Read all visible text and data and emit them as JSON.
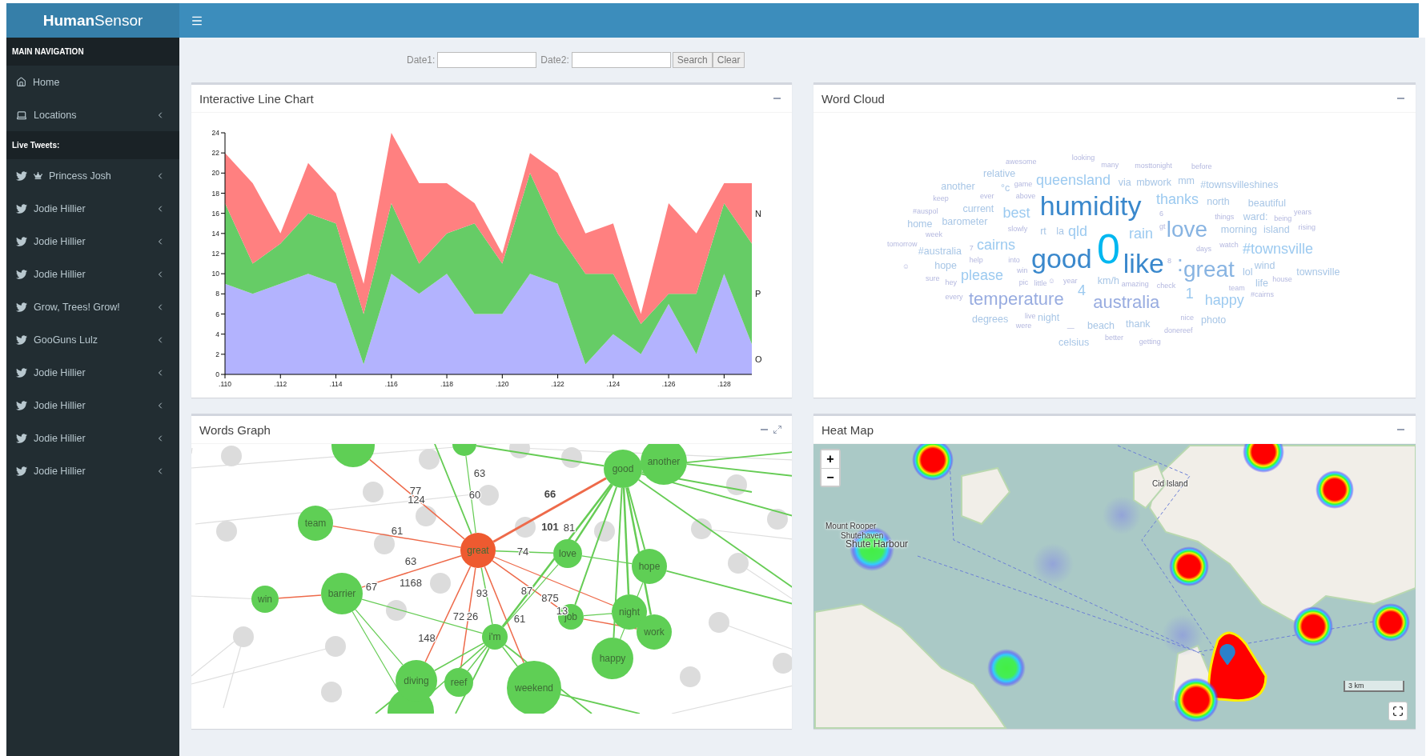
{
  "app": {
    "logo": {
      "bold": "Human",
      "light": "Sensor"
    }
  },
  "sidebar": {
    "sections": [
      {
        "header": "MAIN NAVIGATION",
        "items": [
          {
            "label": "Home",
            "kind": "home",
            "expandable": false
          },
          {
            "label": "Locations",
            "kind": "device",
            "expandable": true
          }
        ]
      },
      {
        "header": "Live Tweets:",
        "items": [
          {
            "label": "Princess Josh",
            "kind": "crowned",
            "expandable": true
          },
          {
            "label": "Jodie Hillier",
            "kind": "tweet",
            "expandable": true
          },
          {
            "label": "Jodie Hillier",
            "kind": "tweet",
            "expandable": true
          },
          {
            "label": "Jodie Hillier",
            "kind": "tweet",
            "expandable": true
          },
          {
            "label": "Grow, Trees! Grow!",
            "kind": "tweet",
            "expandable": true
          },
          {
            "label": "GooGuns Lulz",
            "kind": "tweet",
            "expandable": true
          },
          {
            "label": "Jodie Hillier",
            "kind": "tweet",
            "expandable": true
          },
          {
            "label": "Jodie Hillier",
            "kind": "tweet",
            "expandable": true
          },
          {
            "label": "Jodie Hillier",
            "kind": "tweet",
            "expandable": true
          },
          {
            "label": "Jodie Hillier",
            "kind": "tweet",
            "expandable": true
          }
        ]
      }
    ]
  },
  "filter": {
    "date1_label": "Date1:",
    "date2_label": "Date2:",
    "buttons": [
      "Search",
      "Clear"
    ]
  },
  "line_chart": {
    "title": "Interactive Line Chart",
    "chart_data": {
      "type": "area",
      "stacked": true,
      "categories": [
        ".110",
        null,
        ".112",
        null,
        ".114",
        null,
        ".116",
        null,
        ".118",
        null,
        ".120",
        null,
        ".122",
        null,
        ".124",
        null,
        ".126",
        null,
        ".128",
        null
      ],
      "series": [
        {
          "name": "O",
          "color": "#b3b3fe",
          "values": [
            9,
            8,
            9,
            10,
            9,
            1,
            10,
            8,
            10,
            6,
            6,
            10,
            9,
            1,
            4,
            2,
            7,
            2,
            10,
            3
          ]
        },
        {
          "name": "P",
          "color": "#66cc66",
          "values": [
            8,
            3,
            4,
            6,
            6,
            5,
            7,
            3,
            4,
            9,
            5,
            10,
            5,
            9,
            6,
            3,
            1,
            6,
            7,
            10
          ]
        },
        {
          "name": "N",
          "color": "#ff8080",
          "values": [
            5,
            8,
            1,
            5,
            3,
            3,
            7,
            8,
            5,
            2,
            1,
            2,
            6,
            4,
            5,
            1,
            9,
            6,
            2,
            6
          ]
        }
      ],
      "ylim": [
        0,
        24
      ],
      "yticks": [
        0,
        2,
        4,
        6,
        8,
        10,
        12,
        14,
        16,
        18,
        20,
        22,
        24
      ]
    }
  },
  "word_cloud": {
    "title": "Word Cloud",
    "words": [
      {
        "text": "awesome"
      },
      {
        "text": "looking"
      },
      {
        "text": "many"
      },
      {
        "text": "mosttonight"
      },
      {
        "text": "before"
      },
      {
        "text": "relative"
      },
      {
        "text": "°c"
      },
      {
        "text": "game"
      },
      {
        "text": "queensland"
      },
      {
        "text": "via"
      },
      {
        "text": "mbwork"
      },
      {
        "text": "mm"
      },
      {
        "text": "another"
      },
      {
        "text": "#townsvilleshines"
      },
      {
        "text": "keep"
      },
      {
        "text": "ever"
      },
      {
        "text": "above"
      },
      {
        "text": "humidity"
      },
      {
        "text": "thanks"
      },
      {
        "text": "north"
      },
      {
        "text": "beautiful"
      },
      {
        "text": "#auspol"
      },
      {
        "text": "current"
      },
      {
        "text": "best"
      },
      {
        "text": "6"
      },
      {
        "text": "things"
      },
      {
        "text": "ward:"
      },
      {
        "text": "being"
      },
      {
        "text": "years"
      },
      {
        "text": "home"
      },
      {
        "text": "barometer"
      },
      {
        "text": "slowly"
      },
      {
        "text": "rt"
      },
      {
        "text": "la"
      },
      {
        "text": "qld"
      },
      {
        "text": "rain"
      },
      {
        "text": "gt"
      },
      {
        "text": "love"
      },
      {
        "text": "morning"
      },
      {
        "text": "island"
      },
      {
        "text": "rising"
      },
      {
        "text": "week"
      },
      {
        "text": "tomorrow"
      },
      {
        "text": "#australia"
      },
      {
        "text": "7"
      },
      {
        "text": "cairns"
      },
      {
        "text": "0"
      },
      {
        "text": "days"
      },
      {
        "text": "watch"
      },
      {
        "text": "#townsville"
      },
      {
        "text": "☺"
      },
      {
        "text": "help"
      },
      {
        "text": "into"
      },
      {
        "text": "good"
      },
      {
        "text": "like"
      },
      {
        "text": ":"
      },
      {
        "text": "great"
      },
      {
        "text": "8"
      },
      {
        "text": "hope"
      },
      {
        "text": "wind"
      },
      {
        "text": "win"
      },
      {
        "text": "please"
      },
      {
        "text": "lol"
      },
      {
        "text": "townsville"
      },
      {
        "text": "sure"
      },
      {
        "text": "hey"
      },
      {
        "text": "pic"
      },
      {
        "text": "little"
      },
      {
        "text": "☺"
      },
      {
        "text": "year"
      },
      {
        "text": "km/h"
      },
      {
        "text": "amazing"
      },
      {
        "text": "check"
      },
      {
        "text": "life"
      },
      {
        "text": "house"
      },
      {
        "text": "4"
      },
      {
        "text": "team"
      },
      {
        "text": "1"
      },
      {
        "text": "#cairns"
      },
      {
        "text": "every"
      },
      {
        "text": "temperature"
      },
      {
        "text": "australia"
      },
      {
        "text": "happy"
      },
      {
        "text": "degrees"
      },
      {
        "text": "live"
      },
      {
        "text": "night"
      },
      {
        "text": "nice"
      },
      {
        "text": "photo"
      },
      {
        "text": "were"
      },
      {
        "text": "—"
      },
      {
        "text": "beach"
      },
      {
        "text": "thank"
      },
      {
        "text": "donereef"
      },
      {
        "text": "celsius"
      },
      {
        "text": "better"
      },
      {
        "text": "getting"
      }
    ]
  },
  "words_graph": {
    "title": "Words Graph",
    "nodes": [
      {
        "label": "team",
        "selected": false
      },
      {
        "label": "win",
        "selected": false
      },
      {
        "label": "barrier",
        "selected": false
      },
      {
        "label": "great",
        "selected": true
      },
      {
        "label": "love",
        "selected": false
      },
      {
        "label": "hope",
        "selected": false
      },
      {
        "label": "good",
        "selected": false
      },
      {
        "label": "another",
        "selected": false
      },
      {
        "label": "night",
        "selected": false
      },
      {
        "label": "job",
        "selected": false
      },
      {
        "label": "work",
        "selected": false
      },
      {
        "label": "happy",
        "selected": false
      },
      {
        "label": "i'm",
        "selected": false
      },
      {
        "label": "diving",
        "selected": false
      },
      {
        "label": "reef",
        "selected": false
      },
      {
        "label": "weekend",
        "selected": false
      }
    ],
    "edge_labels": [
      {
        "text": "63",
        "emphasized": false
      },
      {
        "text": "77",
        "emphasized": false
      },
      {
        "text": "124",
        "emphasized": false
      },
      {
        "text": "60",
        "emphasized": false
      },
      {
        "text": "66",
        "emphasized": true
      },
      {
        "text": "101",
        "emphasized": true
      },
      {
        "text": "81",
        "emphasized": false
      },
      {
        "text": "61",
        "emphasized": false
      },
      {
        "text": "74",
        "emphasized": false
      },
      {
        "text": "63",
        "emphasized": false
      },
      {
        "text": "67",
        "emphasized": false
      },
      {
        "text": "1168",
        "emphasized": false
      },
      {
        "text": "93",
        "emphasized": false
      },
      {
        "text": "87",
        "emphasized": false
      },
      {
        "text": "875",
        "emphasized": false
      },
      {
        "text": "72",
        "emphasized": false
      },
      {
        "text": "26",
        "emphasized": false
      },
      {
        "text": "61",
        "emphasized": false
      },
      {
        "text": "148",
        "emphasized": false
      },
      {
        "text": "13",
        "emphasized": false
      }
    ]
  },
  "heat_map": {
    "title": "Heat Map",
    "zoom_in": "+",
    "zoom_out": "−",
    "places": [
      "Cid Island",
      "Mount Rooper",
      "Shutehaven",
      "Shute Harbour"
    ],
    "scale": "3 km"
  }
}
